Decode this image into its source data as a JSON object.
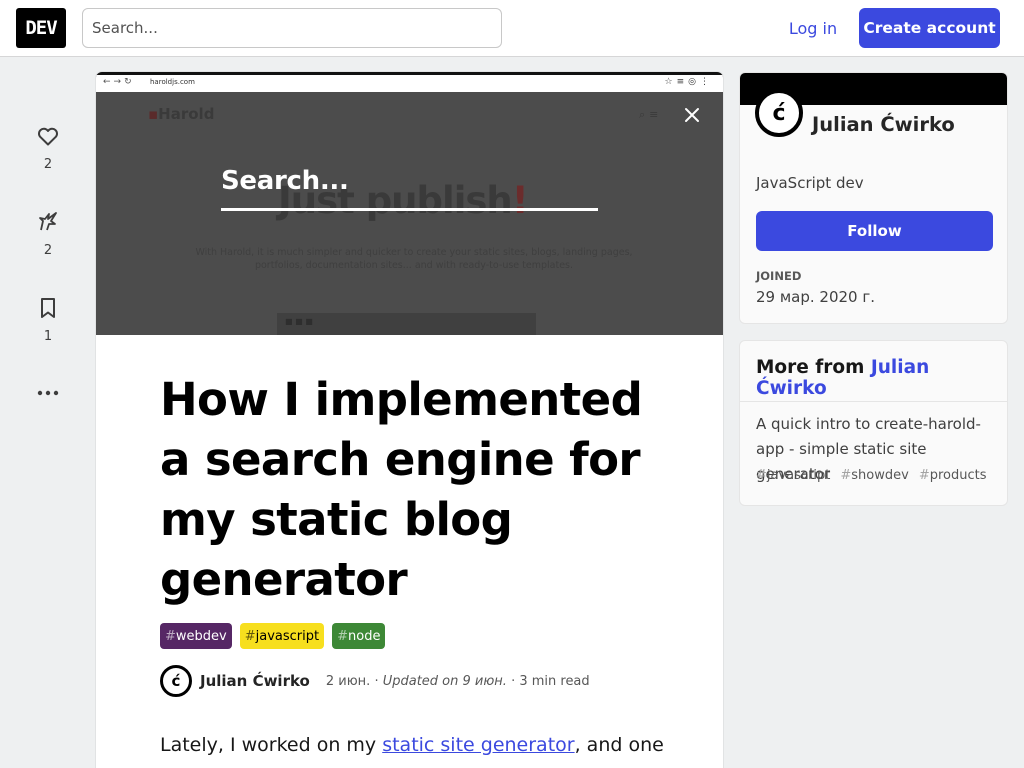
{
  "header": {
    "logo": "DEV",
    "search_placeholder": "Search...",
    "login": "Log in",
    "create_account": "Create account"
  },
  "reactions": {
    "hearts": "2",
    "unicorns": "2",
    "bookmarks": "1"
  },
  "cover": {
    "browser_url": "haroldjs.com",
    "brand": "Harold",
    "search_text": "Search...",
    "bg_title": "Just publish",
    "bg_title_bang": "!",
    "bg_text": "With Harold, it is much simpler and quicker to create your static sites, blogs, landing pages, portfolios, documentation sites... and with ready-to-use templates."
  },
  "article": {
    "title": "How I implemented a search engine for my static blog generator",
    "tags": [
      {
        "hash": "#",
        "name": "webdev",
        "color": "#562765"
      },
      {
        "hash": "#",
        "name": "javascript",
        "color": "#f7df1e"
      },
      {
        "hash": "#",
        "name": "node",
        "color": "#3d8836"
      }
    ],
    "author": "Julian Ćwirko",
    "avatar_letter": "ć",
    "date": "2 июн.",
    "updated": "Updated on 9 июн.",
    "read_time": "3 min read",
    "body_prefix": "Lately, I worked on my ",
    "body_link": "static site generator",
    "body_suffix": ", and one of"
  },
  "profile": {
    "name": "Julian Ćwirko",
    "avatar_letter": "ć",
    "bio": "JavaScript dev",
    "follow": "Follow",
    "joined_label": "Joined",
    "joined_value": "29 мар. 2020 г."
  },
  "more_from": {
    "prefix": "More from ",
    "author": "Julian Ćwirko",
    "item_title": "A quick intro to create-harold-app - simple static site generator",
    "item_tags": [
      "javascript",
      "showdev",
      "products"
    ]
  },
  "colors": {
    "accent": "#3b49df",
    "tag_webdev": "#562765",
    "tag_javascript": "#f7df1e",
    "tag_node": "#3d8836"
  }
}
